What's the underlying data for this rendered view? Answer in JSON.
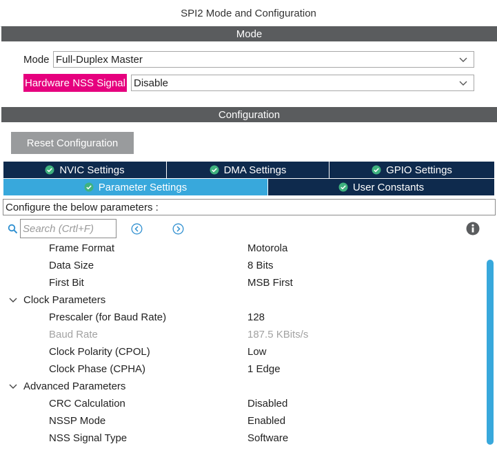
{
  "window": {
    "title": "SPI2 Mode and Configuration"
  },
  "mode_section": {
    "header": "Mode",
    "mode_label": "Mode",
    "mode_value": "Full-Duplex Master",
    "nss_label": "Hardware NSS Signal",
    "nss_value": "Disable"
  },
  "config_section": {
    "header": "Configuration",
    "reset_button": "Reset Configuration",
    "tabs_row1": [
      {
        "label": "NVIC Settings"
      },
      {
        "label": "DMA Settings"
      },
      {
        "label": "GPIO Settings"
      }
    ],
    "tabs_row2": [
      {
        "label": "Parameter Settings",
        "active": true
      },
      {
        "label": "User Constants"
      }
    ],
    "panel_caption": "Configure the below parameters :",
    "search_placeholder": "Search (Crtl+F)"
  },
  "parameters": {
    "top_rows": [
      {
        "name": "Frame Format",
        "value": "Motorola"
      },
      {
        "name": "Data Size",
        "value": "8 Bits"
      },
      {
        "name": "First Bit",
        "value": "MSB First"
      }
    ],
    "clock_group": "Clock Parameters",
    "clock_rows": [
      {
        "name": "Prescaler (for Baud Rate)",
        "value": "128"
      },
      {
        "name": "Baud Rate",
        "value": "187.5 KBits/s",
        "disabled": true
      },
      {
        "name": "Clock Polarity (CPOL)",
        "value": "Low"
      },
      {
        "name": "Clock Phase (CPHA)",
        "value": "1 Edge"
      }
    ],
    "advanced_group": "Advanced Parameters",
    "advanced_rows": [
      {
        "name": "CRC Calculation",
        "value": "Disabled"
      },
      {
        "name": "NSSP Mode",
        "value": "Enabled"
      },
      {
        "name": "NSS Signal Type",
        "value": "Software"
      }
    ]
  },
  "colors": {
    "section_bar": "#5a5c5e",
    "tab_dark": "#0e2a4d",
    "tab_active": "#38a8dc",
    "nss_highlight": "#e6007e",
    "check_green": "#3fb27f",
    "accent_blue": "#38a8dc"
  },
  "icons": {
    "tab_status": "check-circle-icon",
    "search": "search-icon",
    "prev": "prev-icon",
    "next": "next-icon",
    "info": "info-icon",
    "group_toggle": "chevron-down-icon",
    "dropdown": "chevron-down-icon"
  }
}
